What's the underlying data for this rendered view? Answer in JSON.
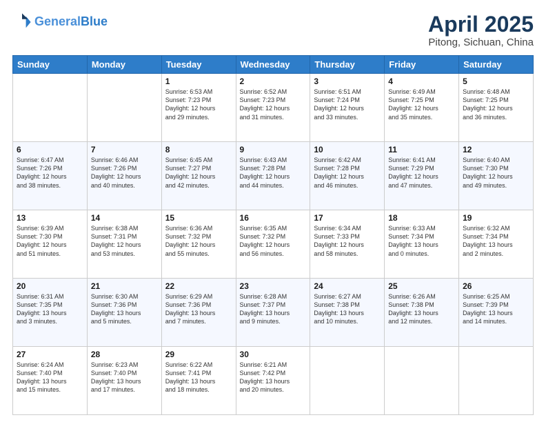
{
  "header": {
    "logo_line1": "General",
    "logo_line2": "Blue",
    "title": "April 2025",
    "subtitle": "Pitong, Sichuan, China"
  },
  "days_of_week": [
    "Sunday",
    "Monday",
    "Tuesday",
    "Wednesday",
    "Thursday",
    "Friday",
    "Saturday"
  ],
  "weeks": [
    [
      {
        "day": "",
        "info": ""
      },
      {
        "day": "",
        "info": ""
      },
      {
        "day": "1",
        "info": "Sunrise: 6:53 AM\nSunset: 7:23 PM\nDaylight: 12 hours\nand 29 minutes."
      },
      {
        "day": "2",
        "info": "Sunrise: 6:52 AM\nSunset: 7:23 PM\nDaylight: 12 hours\nand 31 minutes."
      },
      {
        "day": "3",
        "info": "Sunrise: 6:51 AM\nSunset: 7:24 PM\nDaylight: 12 hours\nand 33 minutes."
      },
      {
        "day": "4",
        "info": "Sunrise: 6:49 AM\nSunset: 7:25 PM\nDaylight: 12 hours\nand 35 minutes."
      },
      {
        "day": "5",
        "info": "Sunrise: 6:48 AM\nSunset: 7:25 PM\nDaylight: 12 hours\nand 36 minutes."
      }
    ],
    [
      {
        "day": "6",
        "info": "Sunrise: 6:47 AM\nSunset: 7:26 PM\nDaylight: 12 hours\nand 38 minutes."
      },
      {
        "day": "7",
        "info": "Sunrise: 6:46 AM\nSunset: 7:26 PM\nDaylight: 12 hours\nand 40 minutes."
      },
      {
        "day": "8",
        "info": "Sunrise: 6:45 AM\nSunset: 7:27 PM\nDaylight: 12 hours\nand 42 minutes."
      },
      {
        "day": "9",
        "info": "Sunrise: 6:43 AM\nSunset: 7:28 PM\nDaylight: 12 hours\nand 44 minutes."
      },
      {
        "day": "10",
        "info": "Sunrise: 6:42 AM\nSunset: 7:28 PM\nDaylight: 12 hours\nand 46 minutes."
      },
      {
        "day": "11",
        "info": "Sunrise: 6:41 AM\nSunset: 7:29 PM\nDaylight: 12 hours\nand 47 minutes."
      },
      {
        "day": "12",
        "info": "Sunrise: 6:40 AM\nSunset: 7:30 PM\nDaylight: 12 hours\nand 49 minutes."
      }
    ],
    [
      {
        "day": "13",
        "info": "Sunrise: 6:39 AM\nSunset: 7:30 PM\nDaylight: 12 hours\nand 51 minutes."
      },
      {
        "day": "14",
        "info": "Sunrise: 6:38 AM\nSunset: 7:31 PM\nDaylight: 12 hours\nand 53 minutes."
      },
      {
        "day": "15",
        "info": "Sunrise: 6:36 AM\nSunset: 7:32 PM\nDaylight: 12 hours\nand 55 minutes."
      },
      {
        "day": "16",
        "info": "Sunrise: 6:35 AM\nSunset: 7:32 PM\nDaylight: 12 hours\nand 56 minutes."
      },
      {
        "day": "17",
        "info": "Sunrise: 6:34 AM\nSunset: 7:33 PM\nDaylight: 12 hours\nand 58 minutes."
      },
      {
        "day": "18",
        "info": "Sunrise: 6:33 AM\nSunset: 7:34 PM\nDaylight: 13 hours\nand 0 minutes."
      },
      {
        "day": "19",
        "info": "Sunrise: 6:32 AM\nSunset: 7:34 PM\nDaylight: 13 hours\nand 2 minutes."
      }
    ],
    [
      {
        "day": "20",
        "info": "Sunrise: 6:31 AM\nSunset: 7:35 PM\nDaylight: 13 hours\nand 3 minutes."
      },
      {
        "day": "21",
        "info": "Sunrise: 6:30 AM\nSunset: 7:36 PM\nDaylight: 13 hours\nand 5 minutes."
      },
      {
        "day": "22",
        "info": "Sunrise: 6:29 AM\nSunset: 7:36 PM\nDaylight: 13 hours\nand 7 minutes."
      },
      {
        "day": "23",
        "info": "Sunrise: 6:28 AM\nSunset: 7:37 PM\nDaylight: 13 hours\nand 9 minutes."
      },
      {
        "day": "24",
        "info": "Sunrise: 6:27 AM\nSunset: 7:38 PM\nDaylight: 13 hours\nand 10 minutes."
      },
      {
        "day": "25",
        "info": "Sunrise: 6:26 AM\nSunset: 7:38 PM\nDaylight: 13 hours\nand 12 minutes."
      },
      {
        "day": "26",
        "info": "Sunrise: 6:25 AM\nSunset: 7:39 PM\nDaylight: 13 hours\nand 14 minutes."
      }
    ],
    [
      {
        "day": "27",
        "info": "Sunrise: 6:24 AM\nSunset: 7:40 PM\nDaylight: 13 hours\nand 15 minutes."
      },
      {
        "day": "28",
        "info": "Sunrise: 6:23 AM\nSunset: 7:40 PM\nDaylight: 13 hours\nand 17 minutes."
      },
      {
        "day": "29",
        "info": "Sunrise: 6:22 AM\nSunset: 7:41 PM\nDaylight: 13 hours\nand 18 minutes."
      },
      {
        "day": "30",
        "info": "Sunrise: 6:21 AM\nSunset: 7:42 PM\nDaylight: 13 hours\nand 20 minutes."
      },
      {
        "day": "",
        "info": ""
      },
      {
        "day": "",
        "info": ""
      },
      {
        "day": "",
        "info": ""
      }
    ]
  ]
}
